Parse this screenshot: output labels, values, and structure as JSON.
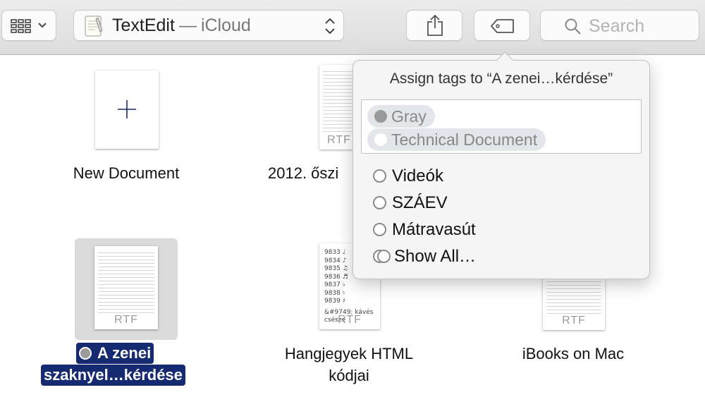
{
  "toolbar": {
    "app_name": "TextEdit",
    "separator": "—",
    "location": "iCloud",
    "search_placeholder": "Search"
  },
  "documents": [
    {
      "label": "New Document"
    },
    {
      "label": "2012. őszi",
      "thumb_type": "RTF"
    },
    {
      "label_line1": "A zenei",
      "label_line2": "szaknyel…kérdése",
      "thumb_type": "RTF",
      "tag_color": "#9b9b9b",
      "selected": true
    },
    {
      "label_line1": "Hangjegyek HTML",
      "label_line2": "kódjai",
      "thumb_type": "RTF",
      "thumb_lines": [
        "9833 ♩",
        "9834 ♪",
        "9835 ♫",
        "9836 ♬",
        "9837 ♭",
        "9838 ♮",
        "9839 ♯"
      ],
      "thumb_footer": "&#9749; kávés csésze"
    },
    {
      "label": "iBooks on Mac",
      "thumb_type": "RTF"
    }
  ],
  "tag_popover": {
    "title": "Assign tags to “A zenei…kérdése”",
    "assigned_tags": [
      {
        "name": "Gray",
        "color": "#9a9a9a"
      },
      {
        "name": "Technical Document",
        "color": "#ffffff"
      }
    ],
    "suggested_tags": [
      "Videók",
      "SZÁEV",
      "Mátravasút"
    ],
    "show_all": "Show All…"
  },
  "colors": {
    "selection": "#162a72",
    "toolbar_bg": "#e4e4e4"
  }
}
